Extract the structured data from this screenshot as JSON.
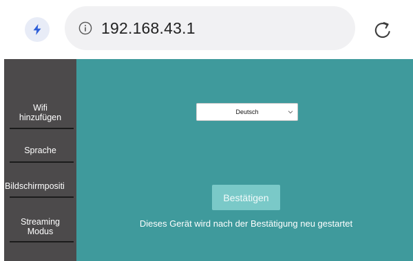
{
  "browser": {
    "url": "192.168.43.1",
    "left_icon": "bolt-icon",
    "info_icon": "info-icon",
    "reload_icon": "reload-icon"
  },
  "sidebar": {
    "items": [
      {
        "label_line1": "Wifi",
        "label_line2": "hinzufügen"
      },
      {
        "label_line1": "Sprache",
        "label_line2": ""
      },
      {
        "label_line1": "Bildschirmpositi",
        "label_line2": ""
      },
      {
        "label_line1": "Streaming",
        "label_line2": "Modus"
      }
    ]
  },
  "main": {
    "language_select": {
      "value": "Deutsch",
      "chevron_icon": "chevron-down-icon"
    },
    "confirm_label": "Bestätigen",
    "restart_note": "Dieses Gerät wird nach der Bestätigung neu gestartet"
  },
  "colors": {
    "sidebar_bg": "#4c4a4b",
    "main_bg": "#3f9a9c",
    "confirm_bg": "#7ac9c8",
    "bolt_accent": "#2f5fd8"
  }
}
